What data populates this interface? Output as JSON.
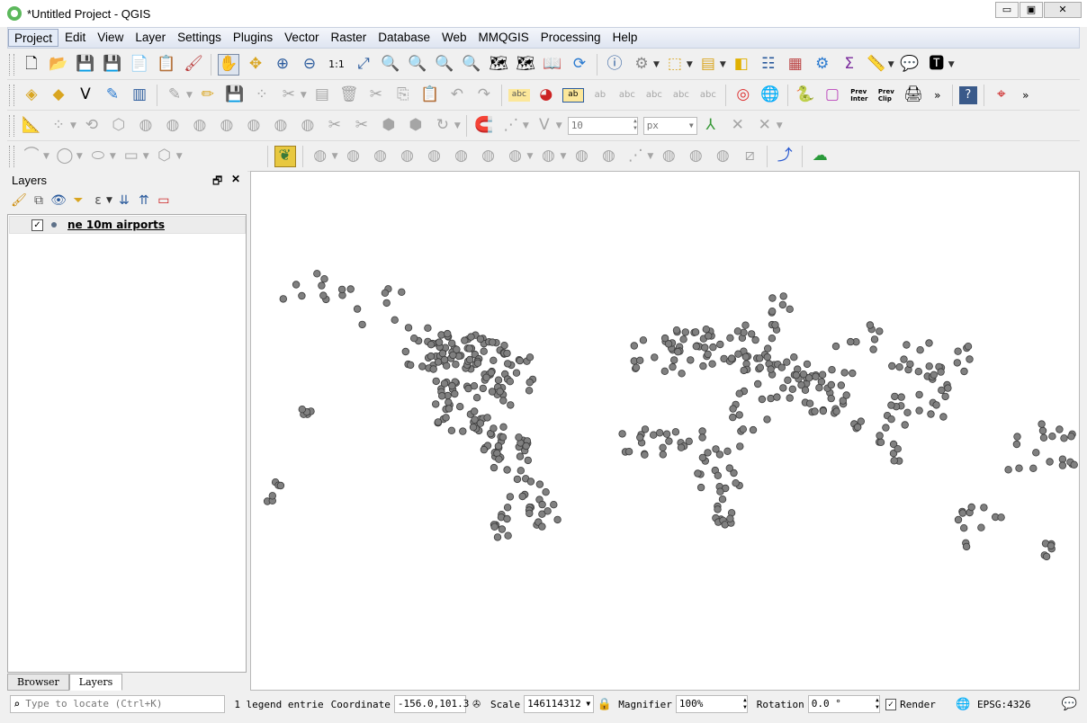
{
  "window": {
    "title": "*Untitled Project - QGIS",
    "controls": {
      "minimize": "▭",
      "restore": "▣",
      "close": "✕"
    }
  },
  "menubar": {
    "items": [
      "Project",
      "Edit",
      "View",
      "Layer",
      "Settings",
      "Plugins",
      "Vector",
      "Raster",
      "Database",
      "Web",
      "MMQGIS",
      "Processing",
      "Help"
    ],
    "active": "Project"
  },
  "toolbar_row3": {
    "snap_tolerance": "10",
    "snap_unit": "px"
  },
  "toolbar_row2": {
    "prev_inter": "Prev\nInter",
    "prev_clip": "Prev\nClip"
  },
  "layers_panel": {
    "title": "Layers",
    "layers": [
      {
        "name": "ne 10m airports",
        "visible": true
      }
    ],
    "tabs": [
      "Browser",
      "Layers"
    ],
    "selected_tab": "Layers"
  },
  "statusbar": {
    "locate_placeholder": "Type to locate (Ctrl+K)",
    "legend_text": "1 legend entrie",
    "coordinate_label": "Coordinate",
    "coordinate_value": "-156.0,101.3",
    "scale_label": "Scale",
    "scale_value": "146114312",
    "magnifier_label": "Magnifier",
    "magnifier_value": "100%",
    "rotation_label": "Rotation",
    "rotation_value": "0.0 °",
    "render_label": "Render",
    "crs": "EPSG:4326"
  },
  "colors": {
    "point_fill": "#808080",
    "point_stroke": "#3a3a3a"
  }
}
